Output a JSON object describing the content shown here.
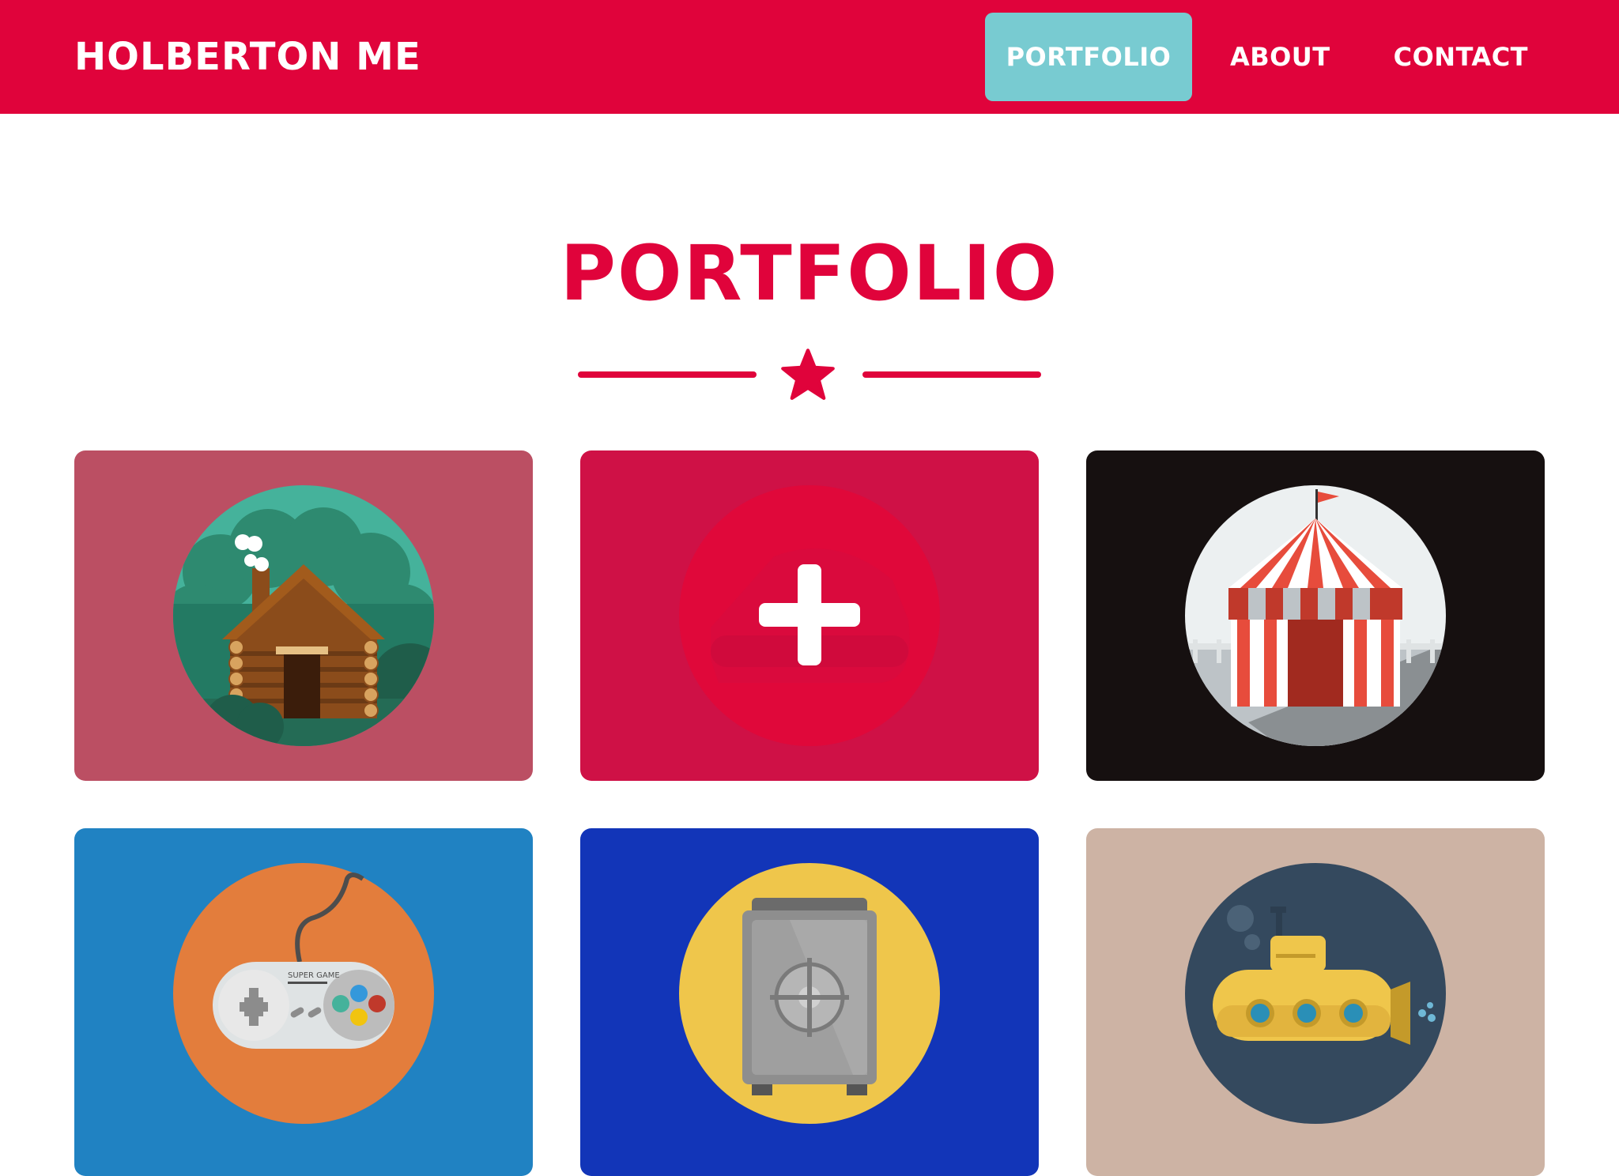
{
  "navbar": {
    "brand": "HOLBERTON ME",
    "links": [
      {
        "label": "PORTFOLIO",
        "active": true
      },
      {
        "label": "ABOUT",
        "active": false
      },
      {
        "label": "CONTACT",
        "active": false
      }
    ],
    "colors": {
      "background": "#e0033b",
      "active": "#78cbd1"
    }
  },
  "portfolio": {
    "title": "PORTFOLIO",
    "divider_icon": "star-icon",
    "accent_color": "#e0033b",
    "items": [
      {
        "icon": "log-cabin-icon",
        "background": "#bb4f63",
        "hovered": false
      },
      {
        "icon": "plus-icon",
        "background": "#cf1146",
        "hovered": true
      },
      {
        "icon": "circus-tent-icon",
        "background": "#161010",
        "hovered": false
      },
      {
        "icon": "game-controller-icon",
        "background": "#2082c2",
        "hovered": false,
        "label": "SUPER GAME"
      },
      {
        "icon": "safe-icon",
        "background": "#1235b8",
        "hovered": false
      },
      {
        "icon": "submarine-icon",
        "background": "#cdb3a4",
        "hovered": false
      }
    ]
  }
}
